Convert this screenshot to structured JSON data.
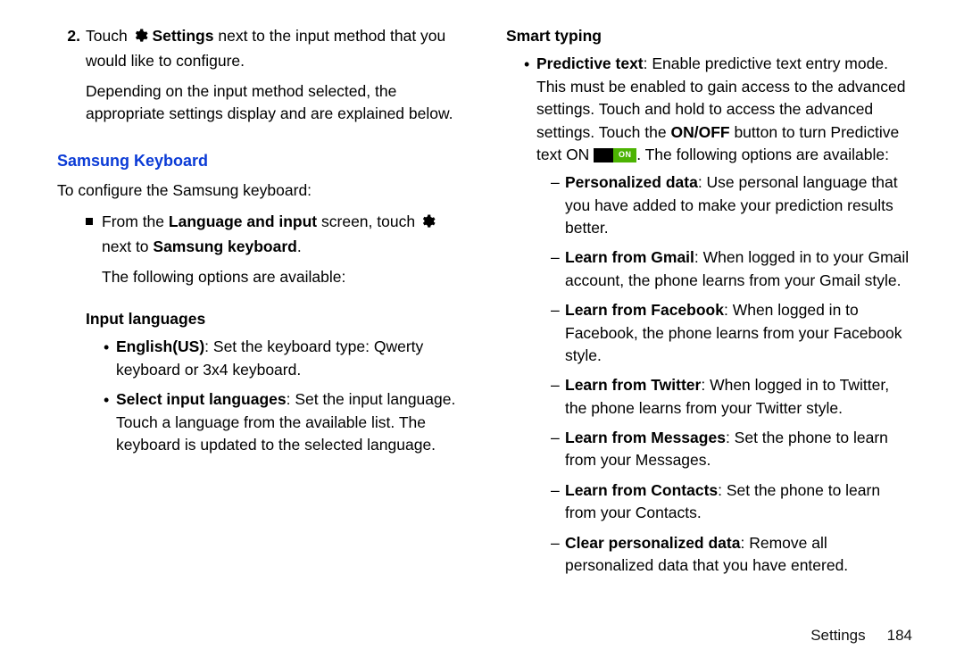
{
  "left": {
    "step_num": "2.",
    "step_line1_pre": "Touch ",
    "step_line1_bold": "Settings",
    "step_line1_post": " next to the input method that you would like to configure.",
    "step_line2": "Depending on the input method selected, the appropriate settings display and are explained below.",
    "section_title": "Samsung Keyboard",
    "intro": "To configure the Samsung keyboard:",
    "sq_pre": "From the ",
    "sq_bold1": "Language and input",
    "sq_mid": " screen, touch ",
    "sq_post_pre": " next to ",
    "sq_bold2": "Samsung keyboard",
    "sq_period": ".",
    "sq_after": "The following options are available:",
    "sub_input_languages": "Input languages",
    "il_b1_bold": "English(US)",
    "il_b1_text": ": Set the keyboard type: Qwerty keyboard or 3x4 keyboard.",
    "il_b2_bold": "Select input languages",
    "il_b2_text": ": Set the input language. Touch a language from the available list. The keyboard is updated to the selected language."
  },
  "right": {
    "sub_smart_typing": "Smart typing",
    "pt_bold": "Predictive text",
    "pt_text1": ": Enable predictive text entry mode. This must be enabled to gain access to the advanced settings. Touch and hold to access the advanced settings. Touch the ",
    "pt_onoff": "ON/OFF",
    "pt_text2": " button to turn Predictive text ON ",
    "pt_text3": ". The following options are available:",
    "on_label": "ON",
    "d1_bold": "Personalized data",
    "d1_text": ": Use personal language that you have added to make your prediction results better.",
    "d2_bold": "Learn from Gmail",
    "d2_text": ": When logged in to your Gmail account, the phone learns from your Gmail style.",
    "d3_bold": "Learn from Facebook",
    "d3_text": ": When logged in to Facebook, the phone learns from your Facebook style.",
    "d4_bold": "Learn from Twitter",
    "d4_text": ": When logged in to Twitter, the phone learns from your Twitter style.",
    "d5_bold": "Learn from Messages",
    "d5_text": ": Set the phone to learn from your Messages.",
    "d6_bold": "Learn from Contacts",
    "d6_text": ": Set the phone to learn from your Contacts.",
    "d7_bold": "Clear personalized data",
    "d7_text": ": Remove all personalized data that you have entered."
  },
  "footer": {
    "section": "Settings",
    "page": "184"
  }
}
